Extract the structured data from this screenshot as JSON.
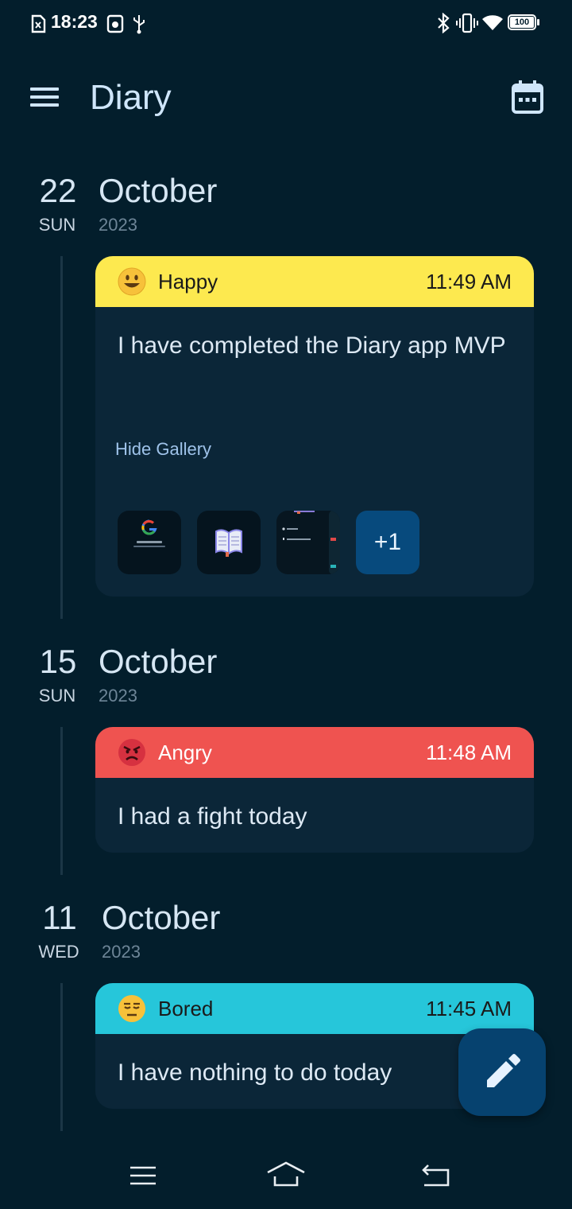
{
  "status_bar": {
    "time": "18:23",
    "battery": "100",
    "icons": [
      "sim-card-icon",
      "data-saver-icon",
      "usb-icon",
      "bluetooth-icon",
      "vibrate-icon",
      "wifi-icon",
      "battery-icon"
    ]
  },
  "app_bar": {
    "title": "Diary",
    "menu_icon": "hamburger-menu-icon",
    "calendar_icon": "calendar-icon"
  },
  "days": [
    {
      "day": "22",
      "weekday": "SUN",
      "month": "October",
      "year": "2023",
      "entries": [
        {
          "mood": "Happy",
          "time": "11:49 AM",
          "color": "#fde94f",
          "text": "I have completed the Diary app MVP",
          "gallery_toggle": "Hide Gallery",
          "gallery_extra": "+1"
        }
      ]
    },
    {
      "day": "15",
      "weekday": "SUN",
      "month": "October",
      "year": "2023",
      "entries": [
        {
          "mood": "Angry",
          "time": "11:48 AM",
          "color": "#ef5350",
          "text": "I had a fight today"
        }
      ]
    },
    {
      "day": "11",
      "weekday": "WED",
      "month": "October",
      "year": "2023",
      "entries": [
        {
          "mood": "Bored",
          "time": "11:45 AM",
          "color": "#26c6da",
          "text": "I have nothing to do today"
        }
      ]
    }
  ],
  "fab": {
    "icon": "pencil-icon"
  },
  "nav_bar": {
    "icons": [
      "recents-icon",
      "home-icon",
      "back-icon"
    ]
  },
  "colors": {
    "background": "#031e2c",
    "card": "#0b2638",
    "accent": "#06426f"
  }
}
